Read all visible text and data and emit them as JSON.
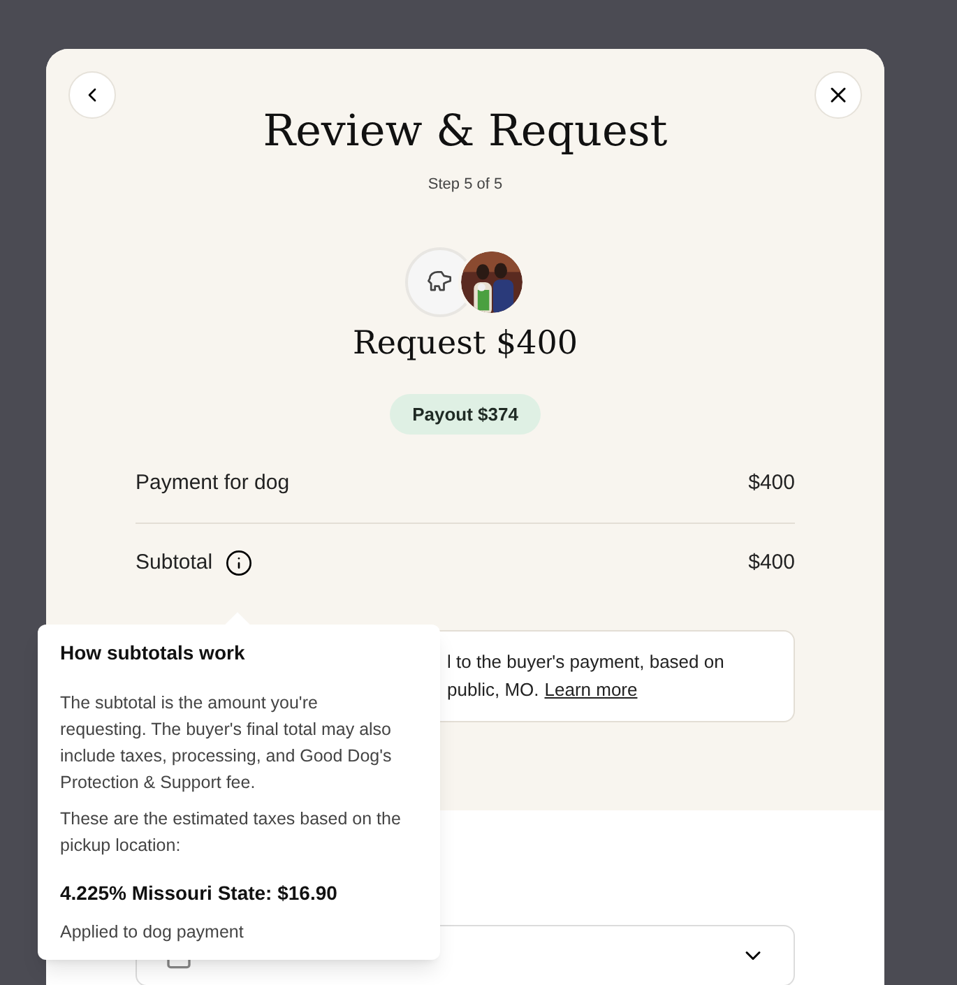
{
  "header": {
    "title": "Review & Request",
    "step": "Step 5 of 5"
  },
  "request": {
    "title": "Request $400",
    "payout": "Payout $374"
  },
  "line_items": [
    {
      "label": "Payment for dog",
      "amount": "$400",
      "info": false
    },
    {
      "label": "Subtotal",
      "amount": "$400",
      "info": true
    }
  ],
  "notice": {
    "lines": [
      "l to the buyer's payment, based on",
      "public, MO."
    ],
    "link": "Learn more"
  },
  "tooltip": {
    "title": "How subtotals work",
    "paragraphs": [
      "The subtotal is the amount you're requesting. The buyer's final total may also include taxes, processing, and Good Dog's Protection & Support fee.",
      "These are the estimated taxes based on the pickup location:"
    ],
    "tax": "4.225% Missouri State: $16.90",
    "note": "Applied to dog payment"
  }
}
